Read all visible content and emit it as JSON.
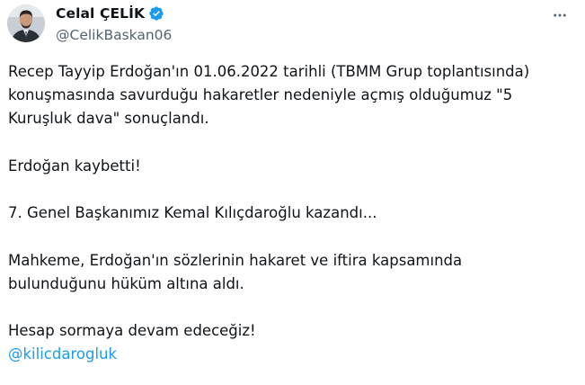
{
  "author": {
    "display_name": "Celal ÇELİK",
    "handle": "@CelikBaskan06",
    "verified": true,
    "verified_color": "#1d9bf0",
    "avatar_icon": "avatar-portrait"
  },
  "menu": {
    "more_icon": "more-horizontal-icon"
  },
  "tweet": {
    "lines": [
      "Recep Tayyip Erdoğan'ın 01.06.2022 tarihli (TBMM Grup toplantısında)",
      "konuşmasında savurduğu hakaretler nedeniyle açmış olduğumuz \"5",
      "Kuruşluk dava\" sonuçlandı.",
      "Erdoğan kaybetti!",
      "7. Genel Başkanımız Kemal Kılıçdaroğlu kazandı...",
      "Mahkeme, Erdoğan'ın sözlerinin hakaret ve iftira kapsamında",
      "bulunduğunu hüküm altına aldı.",
      "Hesap sormaya devam edeceğiz!"
    ],
    "mention": "@kilicdarogluk",
    "mention_color": "#1d9bf0"
  }
}
